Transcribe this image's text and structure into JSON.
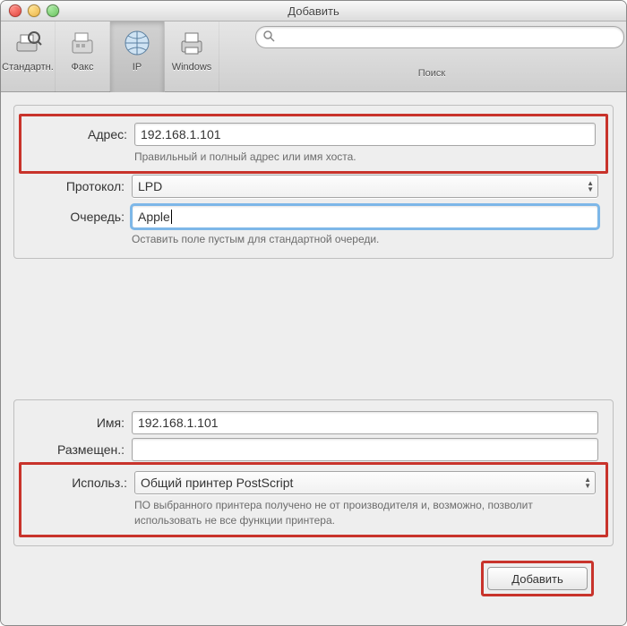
{
  "window": {
    "title": "Добавить"
  },
  "toolbar": {
    "items": [
      {
        "id": "default",
        "label": "Стандартн.",
        "selected": false,
        "icon": "printer-search-icon"
      },
      {
        "id": "fax",
        "label": "Факс",
        "selected": false,
        "icon": "fax-icon"
      },
      {
        "id": "ip",
        "label": "IP",
        "selected": true,
        "icon": "globe-icon"
      },
      {
        "id": "windows",
        "label": "Windows",
        "selected": false,
        "icon": "printer-icon"
      }
    ],
    "search_label": "Поиск",
    "search_placeholder": ""
  },
  "panel1": {
    "address_label": "Адрес:",
    "address_value": "192.168.1.101",
    "address_helper": "Правильный и полный адрес или имя хоста.",
    "protocol_label": "Протокол:",
    "protocol_value": "LPD",
    "queue_label": "Очередь:",
    "queue_value": "Apple",
    "queue_helper": "Оставить поле пустым для стандартной очереди."
  },
  "panel2": {
    "name_label": "Имя:",
    "name_value": "192.168.1.101",
    "location_label": "Размещен.:",
    "location_value": "",
    "use_label": "Использ.:",
    "use_value": "Общий принтер PostScript",
    "use_helper": "ПО выбранного принтера получено не от производителя и, возможно, позволит использовать не все функции принтера."
  },
  "buttons": {
    "add": "Добавить"
  },
  "colors": {
    "highlight": "#c8332b",
    "focus": "#7db7e8"
  }
}
